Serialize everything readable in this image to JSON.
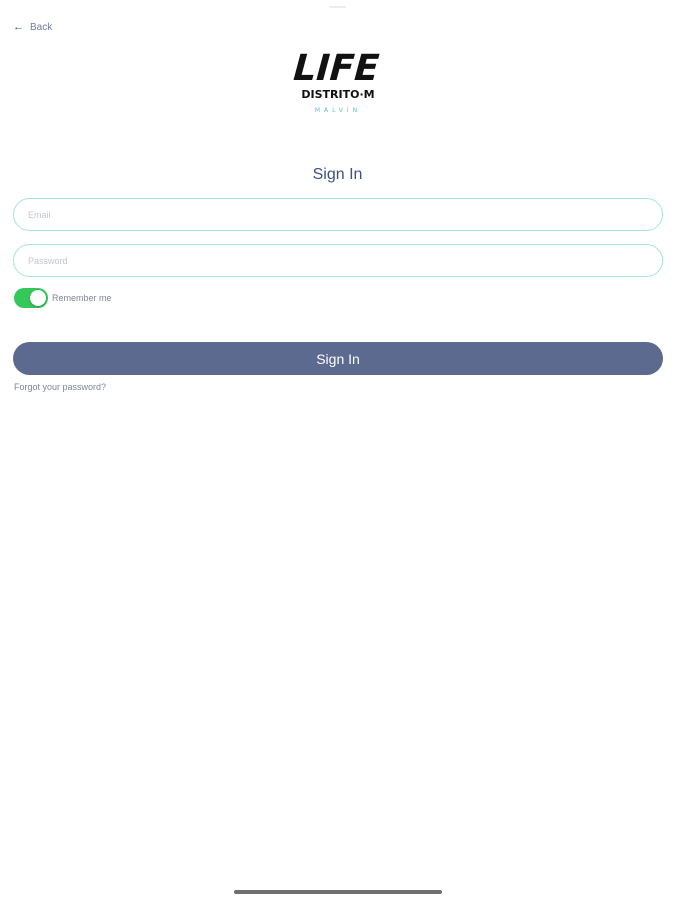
{
  "nav": {
    "back_label": "Back",
    "back_icon": "arrow-left-icon"
  },
  "logo": {
    "line1": "LIFE",
    "line2": "DISTRITO·M",
    "line3": "MALVÍN",
    "accent_color": "#5bbfd4"
  },
  "form": {
    "title": "Sign In",
    "email_placeholder": "Email",
    "email_value": "",
    "password_placeholder": "Password",
    "password_value": "",
    "remember_label": "Remember me",
    "remember_on": true,
    "submit_label": "Sign In",
    "forgot_label": "Forgot your password?"
  },
  "colors": {
    "title": "#3d5087",
    "field_border": "#a6e6d4",
    "toggle_on": "#34c759",
    "button": "#5b6a8e"
  }
}
